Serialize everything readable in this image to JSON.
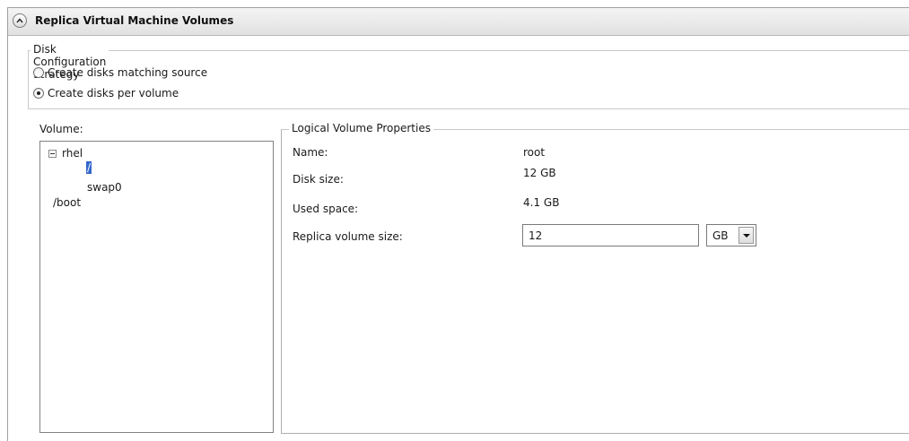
{
  "section": {
    "title": "Replica Virtual Machine Volumes"
  },
  "disk_strategy": {
    "legend": "Disk Configuration Strategy",
    "options": [
      {
        "label": "Create disks matching source",
        "checked": false
      },
      {
        "label": "Create disks per volume",
        "checked": true
      }
    ]
  },
  "volume": {
    "label": "Volume:",
    "tree": {
      "root": "rhel",
      "children": [
        "/",
        "swap0"
      ],
      "siblings": [
        "/boot"
      ],
      "selected": "/"
    }
  },
  "properties": {
    "legend": "Logical Volume Properties",
    "name_label": "Name:",
    "name_value": "root",
    "disk_size_label": "Disk size:",
    "disk_size_value": "12 GB",
    "used_space_label": "Used space:",
    "used_space_value": "4.1 GB",
    "replica_size_label": "Replica volume size:",
    "replica_size_value": "12",
    "unit_selected": "GB"
  },
  "icons": {
    "collapse": "chevron-up-icon",
    "tree_toggle": "minus-box-icon",
    "dropdown": "chevron-down-icon"
  },
  "colors": {
    "selection": "#3366cc",
    "header_bg": "#e6e6e6"
  }
}
